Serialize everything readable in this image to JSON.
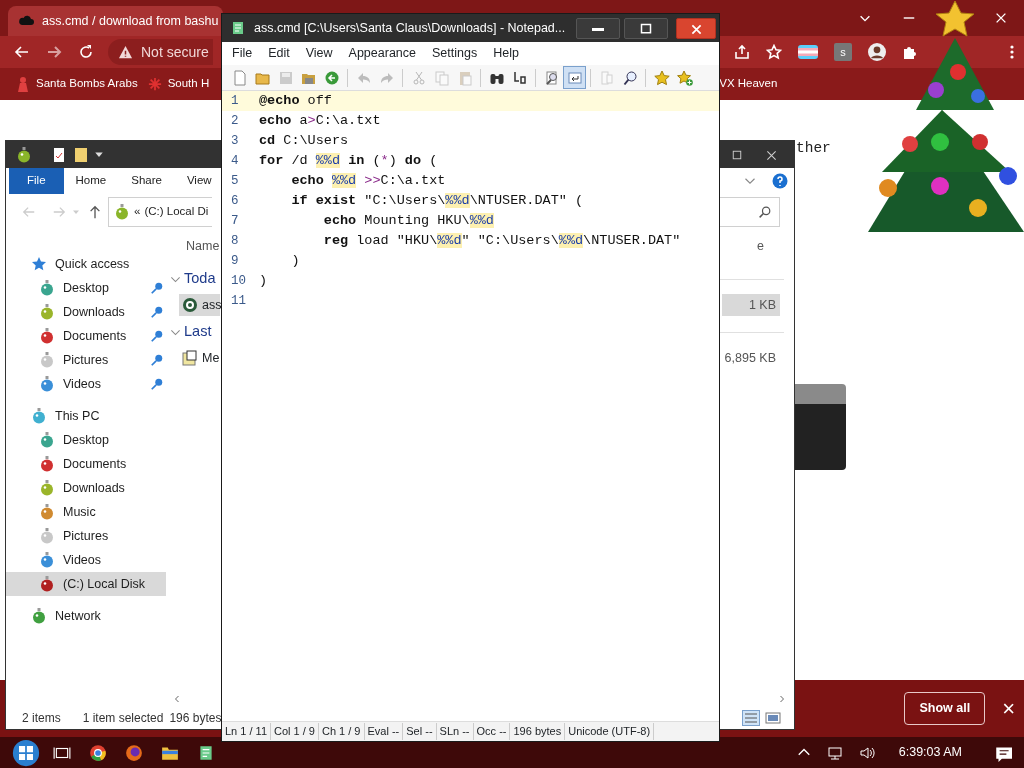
{
  "browser": {
    "tab_title": "ass.cmd / download from bashu",
    "not_secure": "Not secure",
    "extension_badge": "s",
    "bookmarks": [
      {
        "label": "Santa Bombs Arabs",
        "kind": "figure"
      },
      {
        "label": "South H",
        "kind": "snowflake"
      },
      {
        "label": "VX Heaven",
        "kind": "far"
      }
    ],
    "page_text": "ther",
    "download_bar": {
      "show_all": "Show all",
      "close": "×"
    }
  },
  "explorer": {
    "ribbon_tabs": [
      {
        "label": "File",
        "selected": true
      },
      {
        "label": "Home",
        "selected": false
      },
      {
        "label": "Share",
        "selected": false
      },
      {
        "label": "View",
        "selected": false
      }
    ],
    "address_chevron": "«",
    "address": "(C:) Local Di",
    "column_header": "Name",
    "column_header_cut": "e",
    "nav": [
      {
        "label": "Quick access",
        "kind": "quick",
        "color": "#2f7fd6",
        "pinned": false,
        "selected": false
      },
      {
        "label": "Desktop",
        "kind": "item",
        "color": "#3aa58f",
        "pinned": true,
        "selected": false
      },
      {
        "label": "Downloads",
        "kind": "item",
        "color": "#9ab52a",
        "pinned": true,
        "selected": false
      },
      {
        "label": "Documents",
        "kind": "item",
        "color": "#d03030",
        "pinned": true,
        "selected": false
      },
      {
        "label": "Pictures",
        "kind": "item",
        "color": "#c8c8c8",
        "pinned": true,
        "selected": false
      },
      {
        "label": "Videos",
        "kind": "item",
        "color": "#3a8fd8",
        "pinned": true,
        "selected": false
      },
      {
        "label": "This PC",
        "kind": "section",
        "color": "#40b0d0",
        "pinned": false,
        "selected": false
      },
      {
        "label": "Desktop",
        "kind": "item",
        "color": "#3aa58f",
        "pinned": false,
        "selected": false
      },
      {
        "label": "Documents",
        "kind": "item",
        "color": "#d03030",
        "pinned": false,
        "selected": false
      },
      {
        "label": "Downloads",
        "kind": "item",
        "color": "#9ab52a",
        "pinned": false,
        "selected": false
      },
      {
        "label": "Music",
        "kind": "item",
        "color": "#d08a30",
        "pinned": false,
        "selected": false
      },
      {
        "label": "Pictures",
        "kind": "item",
        "color": "#c8c8c8",
        "pinned": false,
        "selected": false
      },
      {
        "label": "Videos",
        "kind": "item",
        "color": "#3a8fd8",
        "pinned": false,
        "selected": false
      },
      {
        "label": "(C:) Local Disk",
        "kind": "item",
        "color": "#b02020",
        "pinned": false,
        "selected": true
      },
      {
        "label": "Network",
        "kind": "section",
        "color": "#40a040",
        "pinned": false,
        "selected": false
      }
    ],
    "groups": [
      {
        "label": "Toda",
        "files": [
          {
            "name": "ass",
            "kind": "script",
            "size": "1 KB",
            "selected": true
          }
        ]
      },
      {
        "label": "Last",
        "files": [
          {
            "name": "Me",
            "kind": "help",
            "size": "6,895 KB",
            "selected": false
          }
        ]
      }
    ],
    "status": {
      "items": "2 items",
      "selection": "1 item selected",
      "size": "196 bytes"
    }
  },
  "notepad": {
    "title": "ass.cmd [C:\\Users\\Santa Claus\\Downloads] - Notepad...",
    "menu": [
      "File",
      "Edit",
      "View",
      "Appearance",
      "Settings",
      "Help"
    ],
    "toolbar": [
      {
        "kind": "button",
        "disabled": false,
        "on": false
      },
      {
        "kind": "button",
        "disabled": false,
        "on": false
      },
      {
        "kind": "button",
        "disabled": true,
        "on": false
      },
      {
        "kind": "button",
        "disabled": false,
        "on": false
      },
      {
        "kind": "button",
        "disabled": false,
        "on": false
      },
      {
        "kind": "sep"
      },
      {
        "kind": "button",
        "disabled": true,
        "on": false
      },
      {
        "kind": "button",
        "disabled": true,
        "on": false
      },
      {
        "kind": "sep"
      },
      {
        "kind": "button",
        "disabled": true,
        "on": false
      },
      {
        "kind": "button",
        "disabled": true,
        "on": false
      },
      {
        "kind": "button",
        "disabled": true,
        "on": false
      },
      {
        "kind": "sep"
      },
      {
        "kind": "button",
        "disabled": false,
        "on": false
      },
      {
        "kind": "button",
        "disabled": false,
        "on": false
      },
      {
        "kind": "sep"
      },
      {
        "kind": "button",
        "disabled": false,
        "on": false
      },
      {
        "kind": "button",
        "disabled": false,
        "on": true
      },
      {
        "kind": "sep"
      },
      {
        "kind": "button",
        "disabled": true,
        "on": false
      },
      {
        "kind": "button",
        "disabled": false,
        "on": false
      },
      {
        "kind": "sep"
      },
      {
        "kind": "button",
        "disabled": false,
        "on": false
      },
      {
        "kind": "button",
        "disabled": false,
        "on": false
      }
    ],
    "lines": [
      {
        "number": "1",
        "current": true,
        "tokens": [
          {
            "kind": "kw",
            "text": "@echo"
          },
          {
            "kind": "text",
            "text": " off"
          }
        ]
      },
      {
        "number": "2",
        "current": false,
        "tokens": [
          {
            "kind": "kw",
            "text": "echo"
          },
          {
            "kind": "text",
            "text": " a"
          },
          {
            "kind": "op",
            "text": ">"
          },
          {
            "kind": "text",
            "text": "C:\\a.txt"
          }
        ]
      },
      {
        "number": "3",
        "current": false,
        "tokens": [
          {
            "kind": "kw",
            "text": "cd"
          },
          {
            "kind": "text",
            "text": " C:\\Users"
          }
        ]
      },
      {
        "number": "4",
        "current": false,
        "tokens": [
          {
            "kind": "kw",
            "text": "for"
          },
          {
            "kind": "text",
            "text": " /d "
          },
          {
            "kind": "var",
            "text": "%%d"
          },
          {
            "kind": "kw",
            "text": " in"
          },
          {
            "kind": "text",
            "text": " ("
          },
          {
            "kind": "op",
            "text": "*"
          },
          {
            "kind": "text",
            "text": ") "
          },
          {
            "kind": "kw",
            "text": "do"
          },
          {
            "kind": "text",
            "text": " ("
          }
        ]
      },
      {
        "number": "5",
        "current": false,
        "tokens": [
          {
            "kind": "kw",
            "text": "    echo "
          },
          {
            "kind": "var",
            "text": "%%d"
          },
          {
            "kind": "op",
            "text": " >>"
          },
          {
            "kind": "text",
            "text": "C:\\a.txt"
          }
        ]
      },
      {
        "number": "6",
        "current": false,
        "tokens": [
          {
            "kind": "kw",
            "text": "    if exist"
          },
          {
            "kind": "text",
            "text": " \"C:\\Users\\"
          },
          {
            "kind": "var",
            "text": "%%d"
          },
          {
            "kind": "text",
            "text": "\\NTUSER.DAT\" ("
          }
        ]
      },
      {
        "number": "7",
        "current": false,
        "tokens": [
          {
            "kind": "kw",
            "text": "        echo"
          },
          {
            "kind": "text",
            "text": " Mounting HKU\\"
          },
          {
            "kind": "var",
            "text": "%%d"
          }
        ]
      },
      {
        "number": "8",
        "current": false,
        "tokens": [
          {
            "kind": "kw",
            "text": "        reg"
          },
          {
            "kind": "text",
            "text": " load \"HKU\\"
          },
          {
            "kind": "var",
            "text": "%%d"
          },
          {
            "kind": "text",
            "text": "\" \"C:\\Users\\"
          },
          {
            "kind": "var",
            "text": "%%d"
          },
          {
            "kind": "text",
            "text": "\\NTUSER.DAT\""
          }
        ]
      },
      {
        "number": "9",
        "current": false,
        "tokens": [
          {
            "kind": "text",
            "text": "    )"
          }
        ]
      },
      {
        "number": "10",
        "current": false,
        "tokens": [
          {
            "kind": "text",
            "text": ")"
          }
        ]
      },
      {
        "number": "11",
        "current": false
      }
    ],
    "status": [
      "Ln  1 / 11",
      "Col  1 / 9",
      "Ch  1 / 9",
      "Eval  --",
      "Sel  --",
      "SLn  --",
      "Occ  --",
      "196 bytes",
      "Unicode (UTF-8)"
    ]
  },
  "taskbar": {
    "clock": "6:39:03 AM"
  }
}
